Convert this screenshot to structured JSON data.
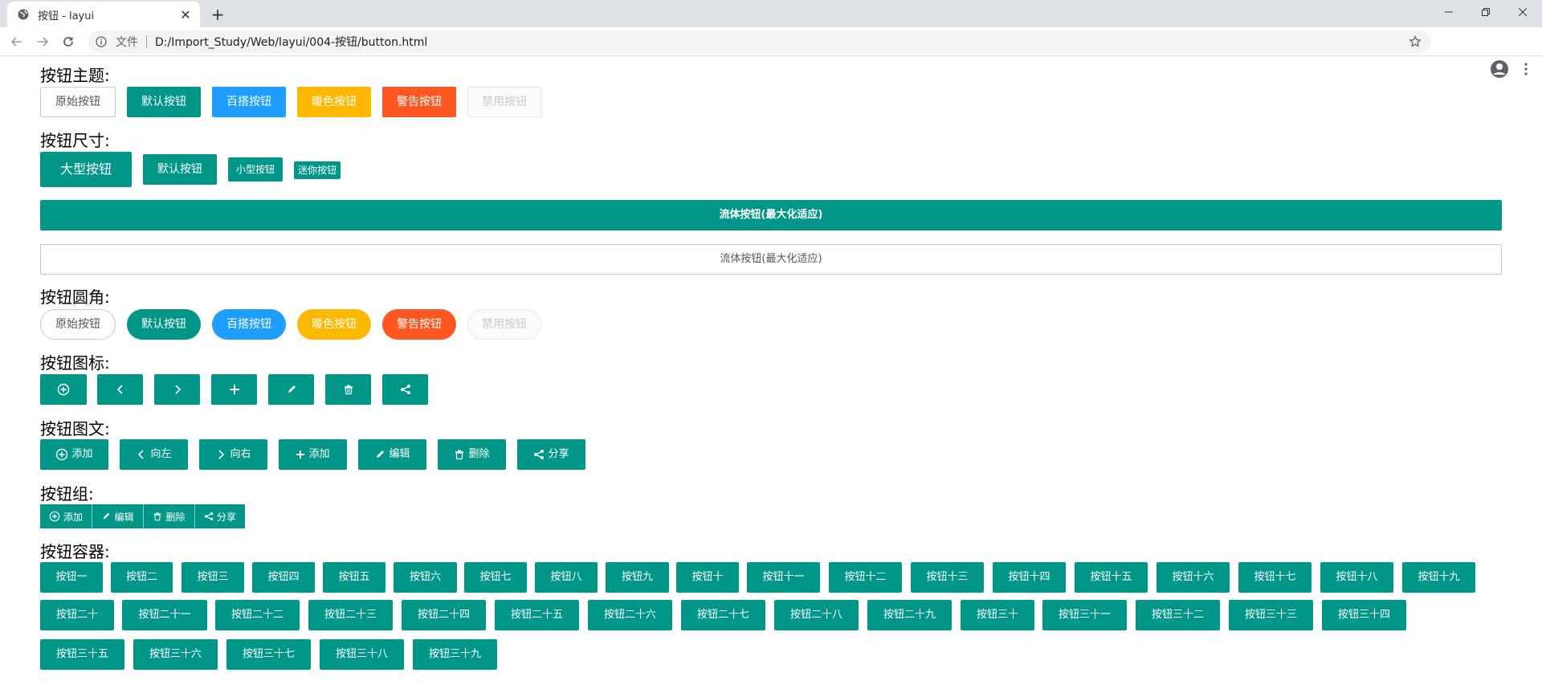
{
  "browser": {
    "tab_title": "按钮 - layui",
    "scheme_label": "文件",
    "url": "D:/Import_Study/Web/layui/004-按钮/button.html"
  },
  "sections": {
    "theme": "按钮主题:",
    "size": "按钮尺寸:",
    "radius": "按钮圆角:",
    "icons": "按钮图标:",
    "icon_text": "按钮图文:",
    "group": "按钮组:",
    "container": "按钮容器:"
  },
  "theme_buttons": [
    "原始按钮",
    "默认按钮",
    "百搭按钮",
    "暖色按钮",
    "警告按钮",
    "禁用按钮"
  ],
  "size_buttons": [
    "大型按钮",
    "默认按钮",
    "小型按钮",
    "迷你按钮"
  ],
  "fluid_label": "流体按钮(最大化适应)",
  "radius_buttons": [
    "原始按钮",
    "默认按钮",
    "百搭按钮",
    "暖色按钮",
    "警告按钮",
    "禁用按钮"
  ],
  "icon_buttons": [
    "add-circle-icon",
    "chevron-left-icon",
    "chevron-right-icon",
    "plus-icon",
    "pencil-icon",
    "trash-icon",
    "share-icon"
  ],
  "icon_text_buttons": [
    "添加",
    "向左",
    "向右",
    "添加",
    "编辑",
    "删除",
    "分享"
  ],
  "group_buttons": [
    "添加",
    "编辑",
    "删除",
    "分享"
  ],
  "container_buttons": [
    "按钮一",
    "按钮二",
    "按钮三",
    "按钮四",
    "按钮五",
    "按钮六",
    "按钮七",
    "按钮八",
    "按钮九",
    "按钮十",
    "按钮十一",
    "按钮十二",
    "按钮十三",
    "按钮十四",
    "按钮十五",
    "按钮十六",
    "按钮十七",
    "按钮十八",
    "按钮十九",
    "按钮二十",
    "按钮二十一",
    "按钮二十二",
    "按钮二十三",
    "按钮二十四",
    "按钮二十五",
    "按钮二十六",
    "按钮二十七",
    "按钮二十八",
    "按钮二十九",
    "按钮三十",
    "按钮三十一",
    "按钮三十二",
    "按钮三十三",
    "按钮三十四",
    "按钮三十五",
    "按钮三十六",
    "按钮三十七",
    "按钮三十八",
    "按钮三十九"
  ],
  "colors": {
    "green": "#009688",
    "blue": "#1E9FFF",
    "warm": "#FFB800",
    "danger": "#FF5722",
    "disabled": "#FBFBFB"
  }
}
